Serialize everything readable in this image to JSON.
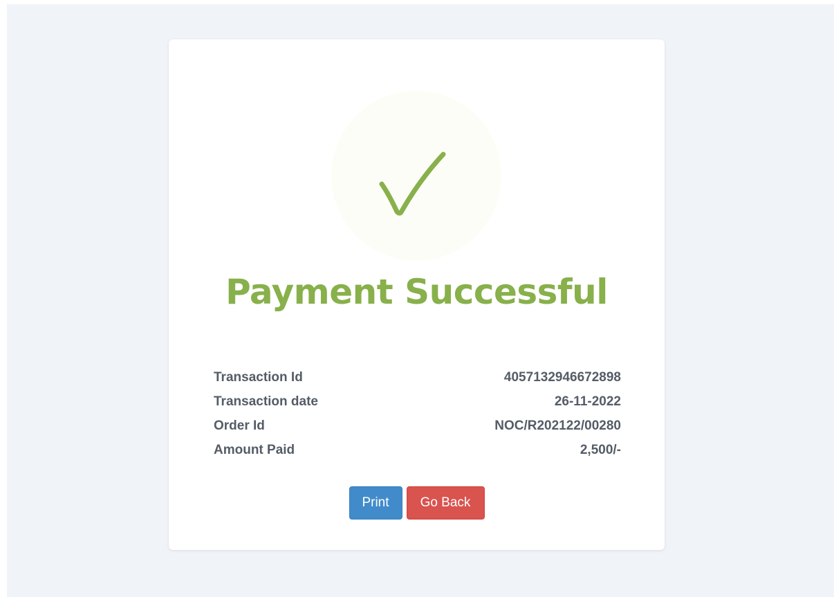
{
  "status": {
    "icon": "checkmark-icon",
    "title": "Payment Successful",
    "accent_color": "#88b04b"
  },
  "details": [
    {
      "label": "Transaction Id",
      "value": "4057132946672898"
    },
    {
      "label": "Transaction date",
      "value": "26-11-2022"
    },
    {
      "label": "Order Id",
      "value": "NOC/R202122/00280"
    },
    {
      "label": "Amount Paid",
      "value": "2,500/-"
    }
  ],
  "actions": {
    "print_label": "Print",
    "print_color": "#428bca",
    "back_label": "Go Back",
    "back_color": "#d9534f"
  }
}
